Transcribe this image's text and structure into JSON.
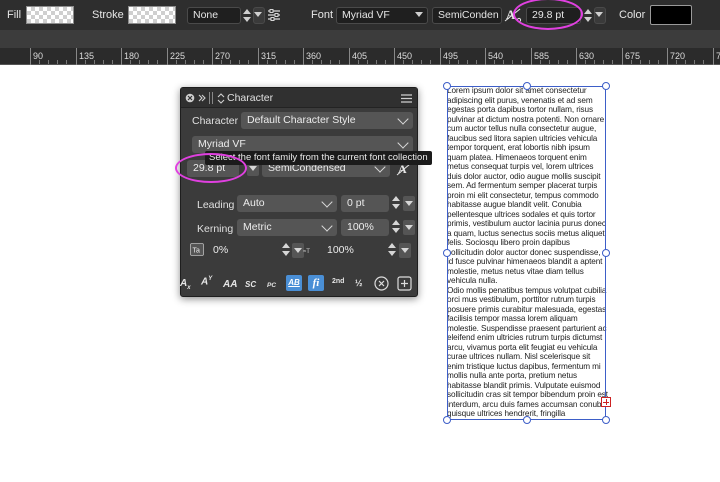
{
  "toolbar": {
    "fill_label": "Fill",
    "stroke_label": "Stroke",
    "stroke_style_value": "None",
    "font_label": "Font",
    "font_family_value": "Myriad VF",
    "font_style_value": "SemiConden",
    "font_size_value": "29.8 pt",
    "color_label": "Color",
    "color_value": "#000000"
  },
  "ruler": {
    "ticks": [
      "90",
      "135",
      "180",
      "225",
      "270",
      "315",
      "360",
      "405",
      "450",
      "495",
      "540",
      "585",
      "630",
      "675",
      "720",
      "765",
      "81"
    ]
  },
  "character_panel": {
    "title": "Character",
    "character_label": "Character",
    "character_style_value": "Default Character Style",
    "font_family_value": "Myriad VF",
    "font_size_value": "29.8 pt",
    "font_style_value": "SemiCondensed",
    "leading_label": "Leading",
    "leading_mode_value": "Auto",
    "leading_value": "0 pt",
    "kerning_label": "Kerning",
    "kerning_mode_value": "Metric",
    "kerning_value": "100%",
    "tracking_value": "0%",
    "baseline_value": "100%",
    "tooltip": "Select the font family from the current font collection",
    "typography_icons": {
      "subscript": "A",
      "superscript": "A",
      "all_caps": "AA",
      "small_caps": "SC",
      "petite_caps": "PC",
      "ab_underline": "AB",
      "ligature": "fi",
      "ordinal": "2nd",
      "fraction": "½"
    }
  },
  "text_frame": {
    "paragraphs": [
      "Lorem ipsum dolor sit amet consectetur adipiscing elit purus, venenatis et ad sem egestas porta dapibus tortor nullam, risus pulvinar at dictum nostra potenti. Non ornare cum auctor tellus nulla consectetur augue, faucibus sed litora sapien ultricies vehicula tempor torquent, erat lobortis nibh ipsum quam platea. Himenaeos torquent enim metus consequat turpis vel, lorem ultrices duis dolor auctor, odio augue mollis suscipit sem. Ad fermentum semper placerat turpis proin mi elit consectetur, tempus commodo habitasse augue blandit velit. Conubia pellentesque ultrices sodales et quis tortor primis, vestibulum auctor lacinia purus donec a quam, luctus senectus sociis metus aliquet felis. Sociosqu libero proin dapibus sollicitudin dolor auctor donec suspendisse, id fusce pulvinar himenaeos blandit a aptent molestie, metus netus vitae diam tellus vehicula nulla.",
      "Odio mollis penatibus tempus volutpat cubilia orci mus vestibulum, porttitor rutrum turpis posuere primis curabitur malesuada, egestas facilisis tempor massa lorem aliquam molestie. Suspendisse praesent parturient ac eleifend enim ultricies rutrum turpis dictumst arcu, vivamus porta elit feugiat eu vehicula curae ultrices nullam. Nisl scelerisque sit enim tristique luctus dapibus, fermentum mi mollis nulla ante porta, pretium netus habitasse blandit primis. Vulputate euismod sollicitudin cras sit tempor bibendum proin est interdum, arcu duis fames accumsan conubia quisque ultrices hendrerit, fringilla ullamcorper iaculis dui facilisis potenti lorem venenatis. Bibendum dis sapien volutpat habitasse"
    ]
  },
  "colors": {
    "toolbar_bg": "#2e2e2e",
    "panel_bg": "#3b3b3b",
    "highlight": "#e040e0",
    "frame_border": "#3d5ec8",
    "accent_blue": "#4a8fd6"
  }
}
